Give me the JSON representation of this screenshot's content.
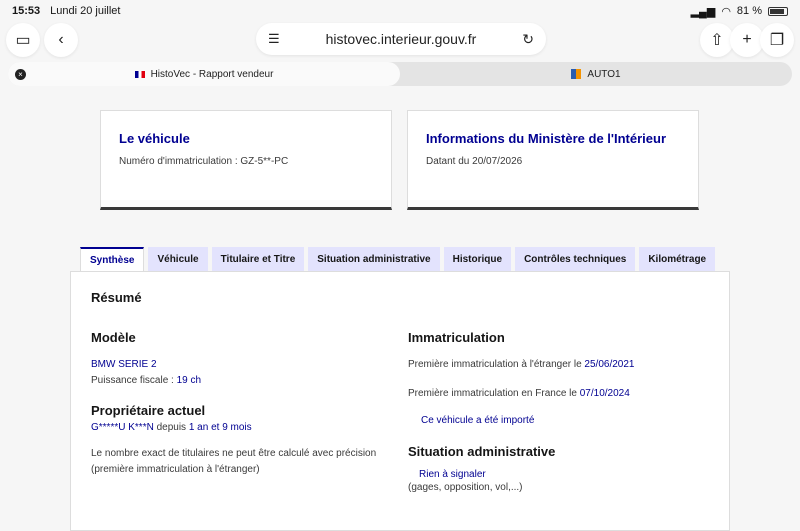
{
  "status": {
    "time": "15:53",
    "date": "Lundi 20 juillet",
    "battery": "81 %"
  },
  "browser": {
    "url": "histovec.interieur.gouv.fr",
    "tabs": [
      {
        "label": "HistoVec - Rapport vendeur"
      },
      {
        "label": "AUTO1"
      }
    ]
  },
  "cards": {
    "vehicle": {
      "title": "Le véhicule",
      "text": "Numéro d'immatriculation : GZ-5**-PC"
    },
    "ministry": {
      "title": "Informations du Ministère de l'Intérieur",
      "text": "Datant du 20/07/2026"
    }
  },
  "tabs": [
    "Synthèse",
    "Véhicule",
    "Titulaire et Titre",
    "Situation administrative",
    "Historique",
    "Contrôles techniques",
    "Kilométrage"
  ],
  "summary": {
    "title": "Résumé",
    "model": {
      "heading": "Modèle",
      "name": "BMW SERIE 2",
      "power_label": "Puissance fiscale : ",
      "power_value": "19 ch"
    },
    "owner": {
      "heading": "Propriétaire actuel",
      "name": "G*****U K***N",
      "since_label": " depuis ",
      "since_value": "1 an et 9 mois",
      "note_1": "Le nombre exact de titulaires ne peut être calculé avec précision",
      "note_2": "(première immatriculation à l'étranger)"
    },
    "registration": {
      "heading": "Immatriculation",
      "foreign_label": "Première immatriculation à l'étranger le ",
      "foreign_date": "25/06/2021",
      "france_label": "Première immatriculation en France le ",
      "france_date": "07/10/2024",
      "imported": "Ce véhicule a été importé"
    },
    "admin": {
      "heading": "Situation administrative",
      "status": "Rien à signaler",
      "detail": "(gages, opposition, vol,...)"
    }
  }
}
